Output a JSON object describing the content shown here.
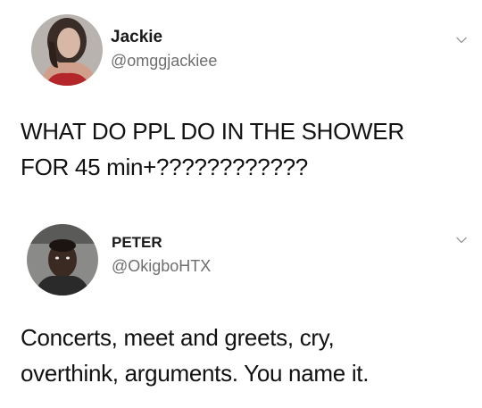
{
  "tweets": [
    {
      "name": "Jackie",
      "handle": "@omggjackiee",
      "text_lines": [
        "WHAT DO PPL DO IN THE SHOWER",
        "FOR 45 min+????????????"
      ]
    },
    {
      "name": "PETER",
      "handle": "@OkigboHTX",
      "text_lines": [
        "Concerts, meet and greets, cry,",
        "overthink, arguments. You name it."
      ]
    }
  ],
  "icons": {
    "menu": "chevron-down-icon"
  }
}
